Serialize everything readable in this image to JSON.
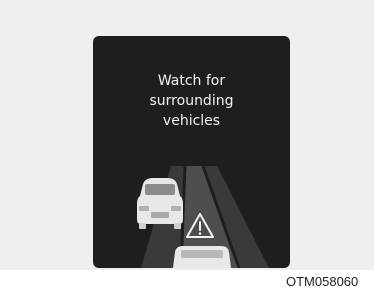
{
  "warning": {
    "lines": [
      "Watch for",
      "surrounding",
      "vehicles"
    ]
  },
  "icons": {
    "warning": "warning-triangle-icon",
    "adjacent_vehicle": "car-rear-icon",
    "own_vehicle": "car-front-icon"
  },
  "figure_code": "OTM058060",
  "colors": {
    "screen": "#1e1e1e",
    "lane": "#4a4a4a",
    "text": "#f2f2f2",
    "frame": "#efefef"
  }
}
